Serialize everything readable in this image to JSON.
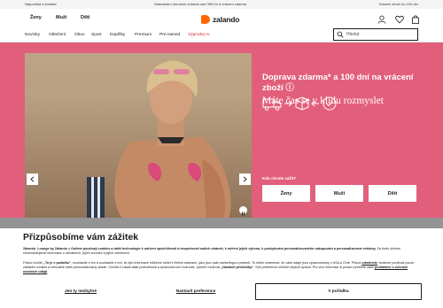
{
  "topbar": {
    "help": "Nápověda a kontakt",
    "shipping": "Standardní doručení zdarma nad 399 Kč a vrácení zdarma",
    "returns": "Vrácení zboží do 100 dní"
  },
  "header": {
    "genders": [
      "Ženy",
      "Muži",
      "Děti"
    ],
    "logo_text": "zalando",
    "brand_color": "#ff6900",
    "icons": [
      "user-icon",
      "heart-icon",
      "bag-icon"
    ]
  },
  "categories": [
    "Novinky",
    "Oblečení",
    "Obuv",
    "Sport",
    "Doplňky",
    "Premium",
    "Pre-owned",
    "Výprodej %"
  ],
  "search": {
    "placeholder": "Hledat"
  },
  "hero": {
    "background": "#e25f7b",
    "promo_title": "Doprava zdarma* a 100 dní na vrácení zboží ⓘ",
    "promo_subtitle": "Máte čas se v klidu rozmyslet",
    "choose_label": "Kdo chcete zažít?",
    "choose_buttons": [
      "Ženy",
      "Muži",
      "Děti"
    ]
  },
  "cookie": {
    "title": "Přizpůsobíme vám zážitek",
    "paragraph1_parts": [
      "Zalando",
      ", ",
      "Lounge by Zalando",
      " a ",
      "Outlets",
      " používají cookies a další technologie k udržení spolehlivosti a bezpečnosti našich stránek, k měření jejich výkonu, k poskytování personalizovaného nakupování a personalizované reklamy.",
      " Za tímto účelem shromažďujeme informace o uživatelích, jejich chování a jejich zařízeních."
    ],
    "paragraph2_parts": [
      "Pokud zvolíte ",
      "„To je v pořádku“",
      ", souhlasíte s tím a souhlasíte s tím, že tyto informace můžeme sdílet s třetími stranami, jako jsou naši marketingoví partneři. To může znamenat, že vaše údaje jsou zpracovávány v USA a Číně. Pokud ",
      "odmítnete",
      ", budeme používat pouze základní cookies a nebudete vidět personalizovaný obsah. Chcete-li získat další podrobnosti a spravovat své možnosti, vyberte možnost ",
      "„Nastavit předvolby“",
      ". Své preference můžete kdykoli upravit. Pro více informací si prosím přečtěte naše ",
      "prohlášení o ochraně osobních údajů",
      "."
    ],
    "buttons": {
      "reject": "Jen ty nezbytné",
      "settings": "Nastavit preference",
      "accept": "V pořádku"
    }
  }
}
